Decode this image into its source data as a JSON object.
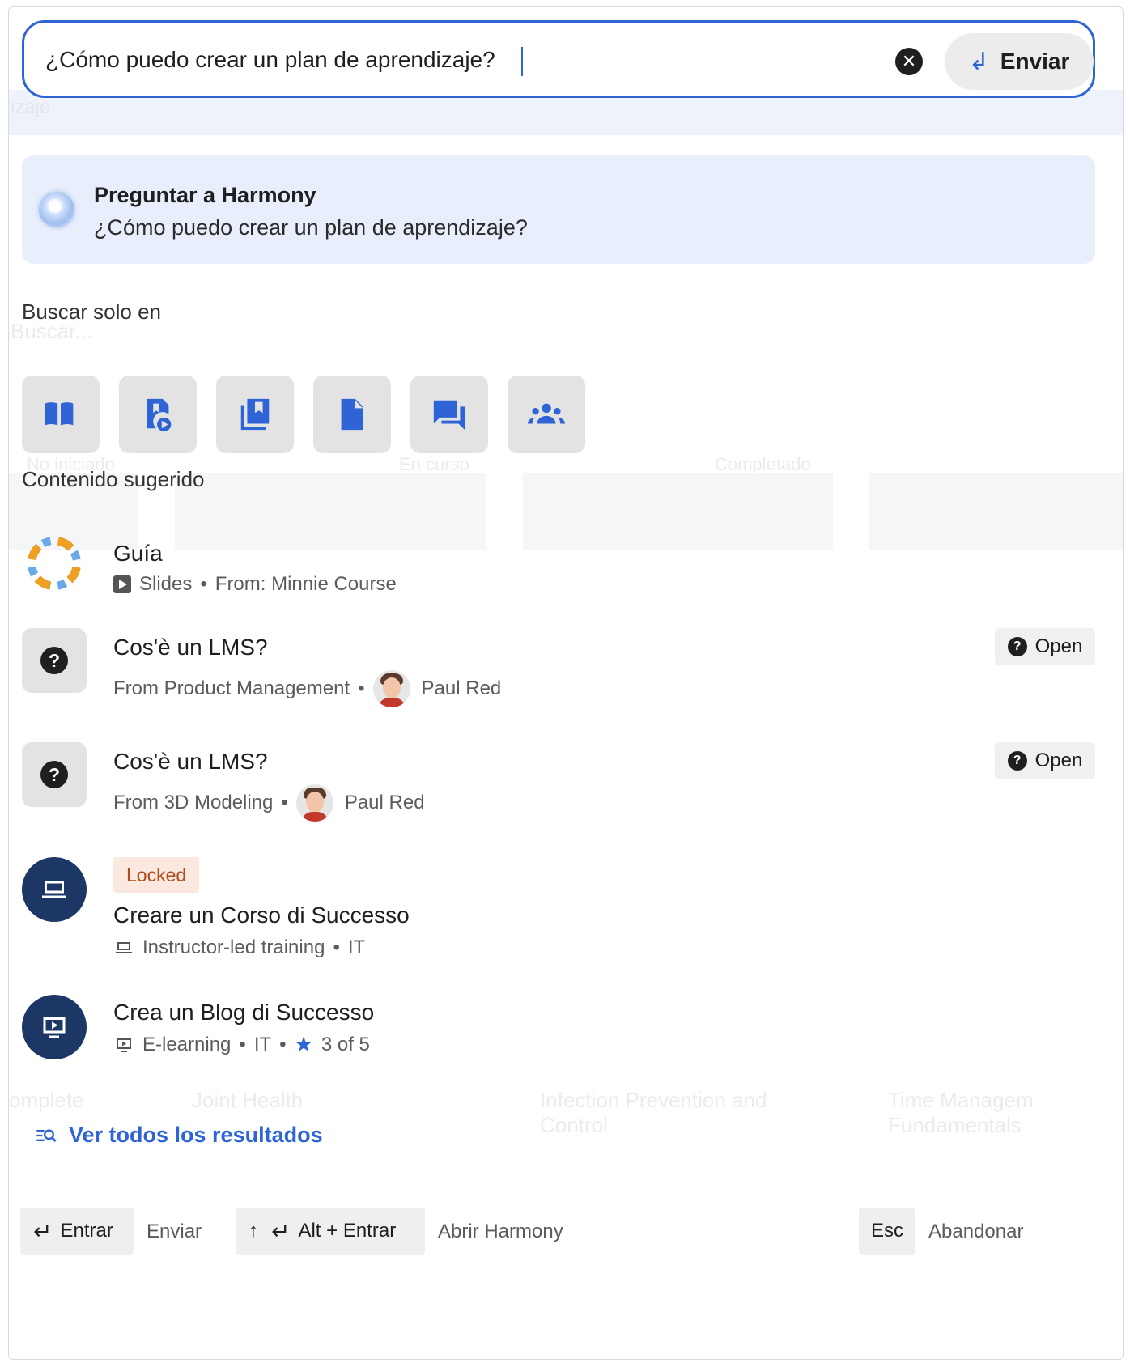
{
  "search": {
    "value": "¿Cómo puedo crear un plan de aprendizaje?",
    "clear_icon": "close-circle-icon",
    "send_label": "Enviar"
  },
  "harmony": {
    "title": "Preguntar a Harmony",
    "query": "¿Cómo puedo crear un plan de aprendizaje?"
  },
  "filters": {
    "label": "Buscar solo en",
    "items": [
      {
        "icon": "book-open-icon"
      },
      {
        "icon": "video-file-icon"
      },
      {
        "icon": "library-icon"
      },
      {
        "icon": "document-icon"
      },
      {
        "icon": "chat-icon"
      },
      {
        "icon": "groups-icon"
      }
    ]
  },
  "suggested": {
    "label": "Contenido sugerido",
    "items": [
      {
        "title": "Guía",
        "type": "Slides",
        "source": "From: Minnie Course"
      },
      {
        "title": "Cos'è un LMS?",
        "source": "From Product Management",
        "author": "Paul Red",
        "action": "Open"
      },
      {
        "title": "Cos'è un LMS?",
        "source": "From 3D Modeling",
        "author": "Paul Red",
        "action": "Open"
      },
      {
        "badge": "Locked",
        "title": "Creare un Corso di Successo",
        "type": "Instructor-led training",
        "lang": "IT"
      },
      {
        "title": "Crea un Blog di Successo",
        "type": "E-learning",
        "lang": "IT",
        "rating": "3 of 5"
      }
    ]
  },
  "see_all": "Ver todos los resultados",
  "footer": {
    "enter_key": "Entrar",
    "enter_label": "Enviar",
    "alt_key": "Alt + Entrar",
    "alt_label": "Abrir Harmony",
    "esc_key": "Esc",
    "esc_label": "Abandonar"
  },
  "background": {
    "ghost_title": "izaje",
    "ghost_search": "Buscar...",
    "ghost_status": [
      "No iniciado",
      "En curso",
      "Completado"
    ],
    "ghost_cards": [
      "omplete",
      "Joint Health",
      "Infection Prevention and Control",
      "Time Managem Fundamentals"
    ]
  }
}
